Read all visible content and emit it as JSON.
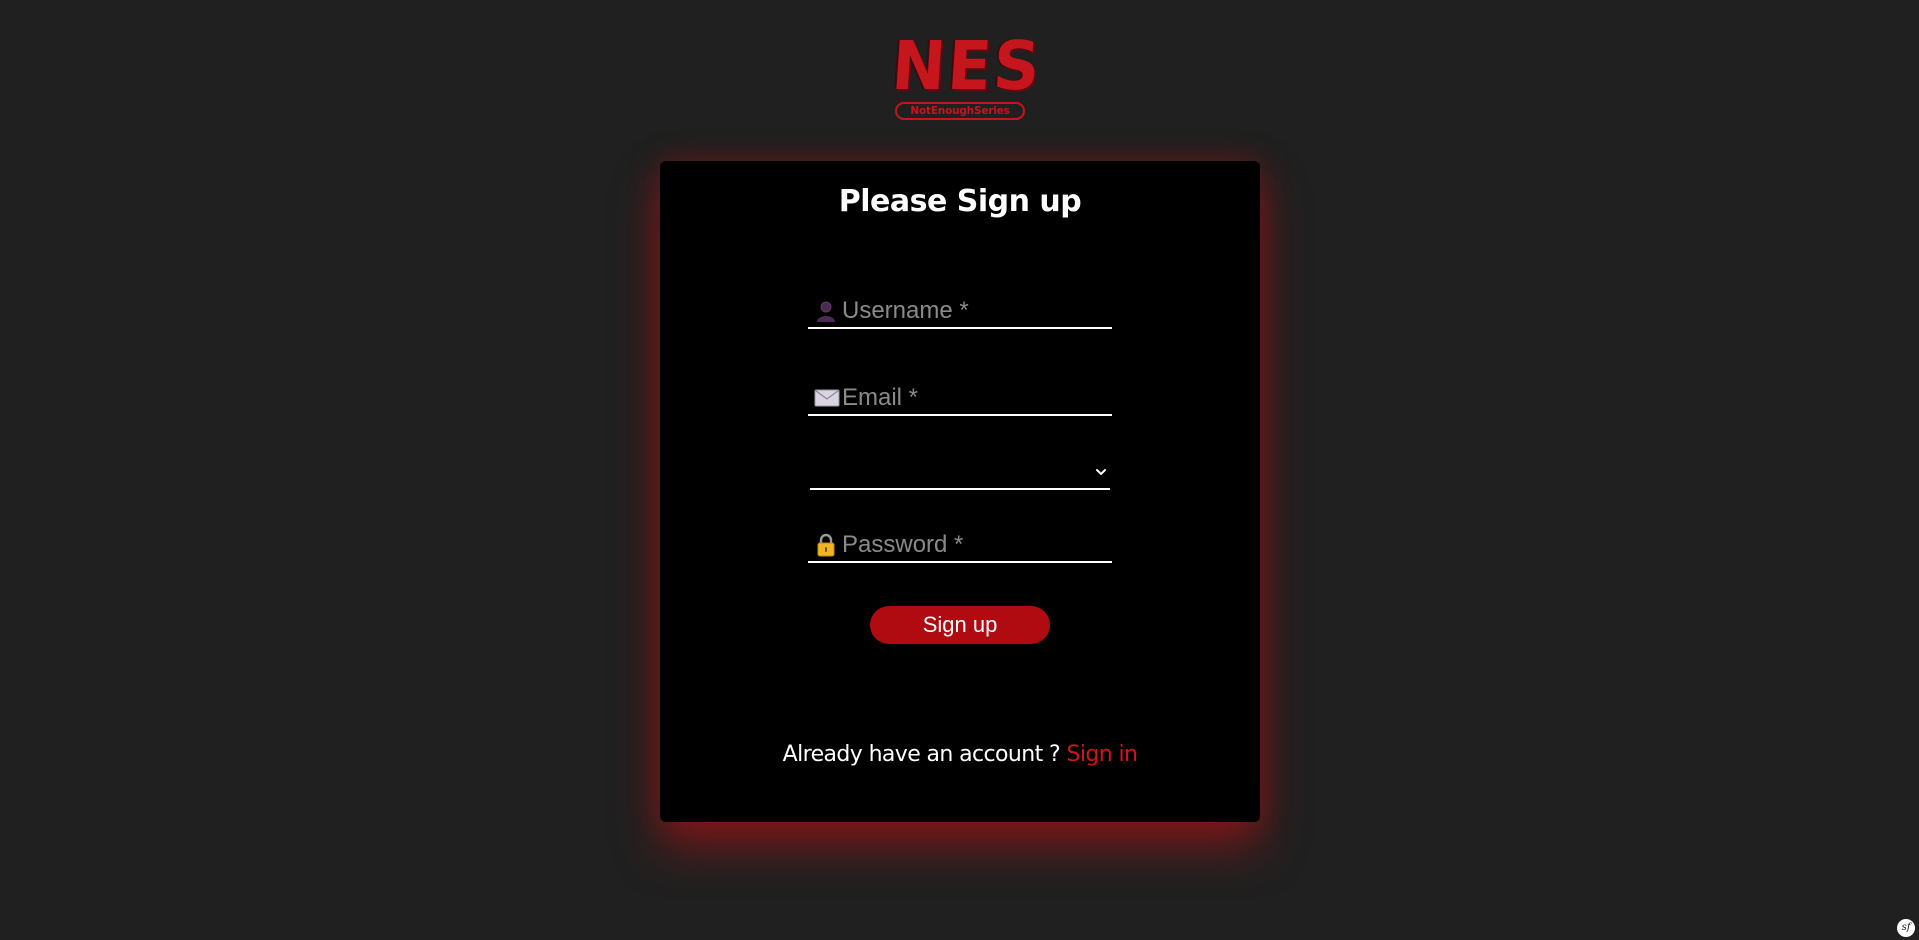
{
  "logo": {
    "letters": "NES",
    "subtitle": "NotEnoughSeries"
  },
  "form": {
    "title": "Please Sign up",
    "username": {
      "placeholder": "Username *",
      "value": "",
      "icon": "user-icon"
    },
    "email": {
      "placeholder": "Email *",
      "value": "",
      "icon": "envelope-icon"
    },
    "select": {
      "value": "",
      "icon": "chevron-down-icon"
    },
    "password": {
      "placeholder": "Password *",
      "value": "",
      "icon": "lock-icon"
    },
    "submit_label": "Sign up",
    "footer_text": "Already have an account ? ",
    "signin_label": "Sign in"
  },
  "debug_toolbar": {
    "label": "sf"
  },
  "colors": {
    "background": "#202020",
    "card": "#000000",
    "accent": "#c4161c",
    "button": "#b00b10",
    "glow": "#b41216"
  }
}
